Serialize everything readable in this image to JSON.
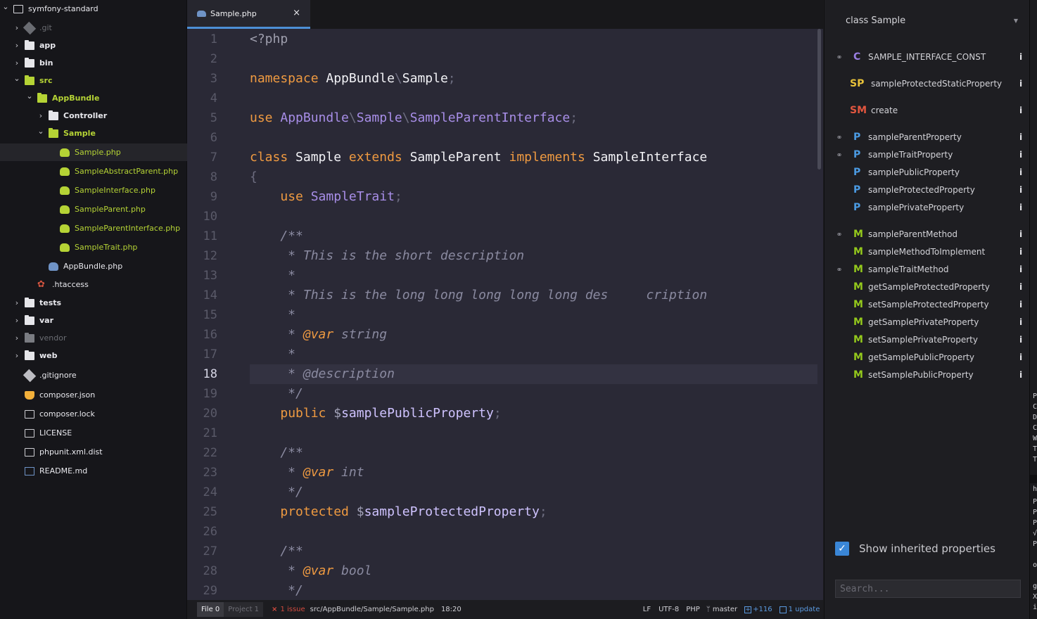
{
  "project": {
    "root": "symfony-standard",
    "tree": [
      {
        "depth": 0,
        "label": "symfony-standard",
        "type": "repo",
        "chev": "down",
        "style": "normal"
      },
      {
        "depth": 1,
        "label": ".git",
        "type": "git-dim",
        "chev": "right",
        "style": "dim"
      },
      {
        "depth": 1,
        "label": "app",
        "type": "folder",
        "chev": "right",
        "style": "bold"
      },
      {
        "depth": 1,
        "label": "bin",
        "type": "folder",
        "chev": "right",
        "style": "bold"
      },
      {
        "depth": 1,
        "label": "src",
        "type": "folder-green",
        "chev": "down",
        "style": "green-bold"
      },
      {
        "depth": 2,
        "label": "AppBundle",
        "type": "folder-green",
        "chev": "down",
        "style": "green-bold"
      },
      {
        "depth": 3,
        "label": "Controller",
        "type": "folder",
        "chev": "right",
        "style": "bold"
      },
      {
        "depth": 3,
        "label": "Sample",
        "type": "folder-green",
        "chev": "down",
        "style": "green-bold"
      },
      {
        "depth": 4,
        "label": "Sample.php",
        "type": "elephant",
        "chev": "",
        "style": "green",
        "selected": true
      },
      {
        "depth": 4,
        "label": "SampleAbstractParent.php",
        "type": "elephant",
        "chev": "",
        "style": "green"
      },
      {
        "depth": 4,
        "label": "SampleInterface.php",
        "type": "elephant",
        "chev": "",
        "style": "green"
      },
      {
        "depth": 4,
        "label": "SampleParent.php",
        "type": "elephant",
        "chev": "",
        "style": "green"
      },
      {
        "depth": 4,
        "label": "SampleParentInterface.php",
        "type": "elephant",
        "chev": "",
        "style": "green"
      },
      {
        "depth": 4,
        "label": "SampleTrait.php",
        "type": "elephant",
        "chev": "",
        "style": "green"
      },
      {
        "depth": 3,
        "label": "AppBundle.php",
        "type": "elephant-blue",
        "chev": "",
        "style": "normal"
      },
      {
        "depth": 2,
        "label": ".htaccess",
        "type": "gear",
        "chev": "",
        "style": "normal"
      },
      {
        "depth": 1,
        "label": "tests",
        "type": "folder",
        "chev": "right",
        "style": "bold"
      },
      {
        "depth": 1,
        "label": "var",
        "type": "folder",
        "chev": "right",
        "style": "bold"
      },
      {
        "depth": 1,
        "label": "vendor",
        "type": "folder-dim",
        "chev": "right",
        "style": "dim"
      },
      {
        "depth": 1,
        "label": "web",
        "type": "folder",
        "chev": "right",
        "style": "bold"
      },
      {
        "depth": 1,
        "label": ".gitignore",
        "type": "git",
        "chev": "",
        "style": "normal"
      },
      {
        "depth": 1,
        "label": "composer.json",
        "type": "composer",
        "chev": "",
        "style": "normal"
      },
      {
        "depth": 1,
        "label": "composer.lock",
        "type": "doc",
        "chev": "",
        "style": "normal"
      },
      {
        "depth": 1,
        "label": "LICENSE",
        "type": "doc",
        "chev": "",
        "style": "normal"
      },
      {
        "depth": 1,
        "label": "phpunit.xml.dist",
        "type": "doc",
        "chev": "",
        "style": "normal"
      },
      {
        "depth": 1,
        "label": "README.md",
        "type": "readme",
        "chev": "",
        "style": "normal"
      }
    ]
  },
  "tab": {
    "title": "Sample.php",
    "close": "×"
  },
  "editor": {
    "active_line": 18,
    "lines": [
      [
        [
          "ph",
          "<?php"
        ]
      ],
      [],
      [
        [
          "kw",
          "namespace "
        ],
        [
          "cls",
          "AppBundle"
        ],
        [
          "punc",
          "\\"
        ],
        [
          "cls",
          "Sample"
        ],
        [
          "punc",
          ";"
        ]
      ],
      [],
      [
        [
          "kw",
          "use "
        ],
        [
          "typ",
          "AppBundle"
        ],
        [
          "punc",
          "\\"
        ],
        [
          "typ",
          "Sample"
        ],
        [
          "punc",
          "\\"
        ],
        [
          "typ",
          "SampleParentInterface"
        ],
        [
          "punc",
          ";"
        ]
      ],
      [],
      [
        [
          "kw",
          "class "
        ],
        [
          "cls",
          "Sample "
        ],
        [
          "kw",
          "extends "
        ],
        [
          "cls",
          "SampleParent "
        ],
        [
          "kw",
          "implements "
        ],
        [
          "cls",
          "SampleInterface"
        ]
      ],
      [
        [
          "punc",
          "{"
        ]
      ],
      [
        [
          "cls",
          "    "
        ],
        [
          "kw",
          "use "
        ],
        [
          "typ",
          "SampleTrait"
        ],
        [
          "punc",
          ";"
        ]
      ],
      [],
      [
        [
          "cm",
          "    /**"
        ]
      ],
      [
        [
          "cm",
          "     * This is the short description"
        ]
      ],
      [
        [
          "cm",
          "     *"
        ]
      ],
      [
        [
          "cm",
          "     * This is the long long long long long des     cription"
        ]
      ],
      [
        [
          "cm",
          "     *"
        ]
      ],
      [
        [
          "cm",
          "     * "
        ],
        [
          "tag",
          "@var"
        ],
        [
          "cm",
          " string"
        ]
      ],
      [
        [
          "cm",
          "     *"
        ]
      ],
      [
        [
          "cm",
          "     * @description"
        ]
      ],
      [
        [
          "cm",
          "     */"
        ]
      ],
      [
        [
          "cls",
          "    "
        ],
        [
          "kw",
          "public "
        ],
        [
          "dol",
          "$"
        ],
        [
          "var",
          "samplePublicProperty"
        ],
        [
          "punc",
          ";"
        ]
      ],
      [],
      [
        [
          "cm",
          "    /**"
        ]
      ],
      [
        [
          "cm",
          "     * "
        ],
        [
          "tag",
          "@var"
        ],
        [
          "cm",
          " int"
        ]
      ],
      [
        [
          "cm",
          "     */"
        ]
      ],
      [
        [
          "cls",
          "    "
        ],
        [
          "kw",
          "protected "
        ],
        [
          "dol",
          "$"
        ],
        [
          "var",
          "sampleProtectedProperty"
        ],
        [
          "punc",
          ";"
        ]
      ],
      [],
      [
        [
          "cm",
          "    /**"
        ]
      ],
      [
        [
          "cm",
          "     * "
        ],
        [
          "tag",
          "@var"
        ],
        [
          "cm",
          " bool"
        ]
      ],
      [
        [
          "cm",
          "     */"
        ]
      ]
    ]
  },
  "status": {
    "file_tab": "File 0",
    "project_tab": "Project 1",
    "issue_icon": "×",
    "issues": "1 issue",
    "path": "src/AppBundle/Sample/Sample.php",
    "cursor": "18:20",
    "line_ending": "LF",
    "encoding": "UTF-8",
    "grammar": "PHP",
    "branch": "master",
    "diff": "+116",
    "updates": "1 update"
  },
  "outline": {
    "class_select": "class Sample",
    "items": [
      {
        "badge": "C",
        "name": "SAMPLE_INTERFACE_CONST",
        "link": true
      },
      {
        "badge": "SP",
        "name": "sampleProtectedStaticProperty",
        "link": false
      },
      {
        "badge": "SM",
        "name": "create",
        "link": false
      },
      {
        "badge": "P",
        "name": "sampleParentProperty",
        "link": true
      },
      {
        "badge": "P",
        "name": "sampleTraitProperty",
        "link": true
      },
      {
        "badge": "P",
        "name": "samplePublicProperty",
        "link": false
      },
      {
        "badge": "P",
        "name": "sampleProtectedProperty",
        "link": false
      },
      {
        "badge": "P",
        "name": "samplePrivateProperty",
        "link": false
      },
      {
        "badge": "M",
        "name": "sampleParentMethod",
        "link": true
      },
      {
        "badge": "M",
        "name": "sampleMethodToImplement",
        "link": false
      },
      {
        "badge": "M",
        "name": "sampleTraitMethod",
        "link": true
      },
      {
        "badge": "M",
        "name": "getSampleProtectedProperty",
        "link": false
      },
      {
        "badge": "M",
        "name": "setSampleProtectedProperty",
        "link": false
      },
      {
        "badge": "M",
        "name": "getSamplePrivateProperty",
        "link": false
      },
      {
        "badge": "M",
        "name": "setSamplePrivateProperty",
        "link": false
      },
      {
        "badge": "M",
        "name": "getSamplePublicProperty",
        "link": false
      },
      {
        "badge": "M",
        "name": "setSamplePublicProperty",
        "link": false
      }
    ],
    "info_glyph": "i",
    "show_inherited": "Show inherited properties",
    "checked": "✓",
    "search_placeholder": "Search..."
  },
  "edge_chars": [
    "P",
    "C",
    "D",
    "C",
    "W",
    "T",
    "T",
    "h",
    "P",
    "P",
    "P",
    "√",
    "P",
    "o",
    "g",
    "X",
    "i"
  ]
}
